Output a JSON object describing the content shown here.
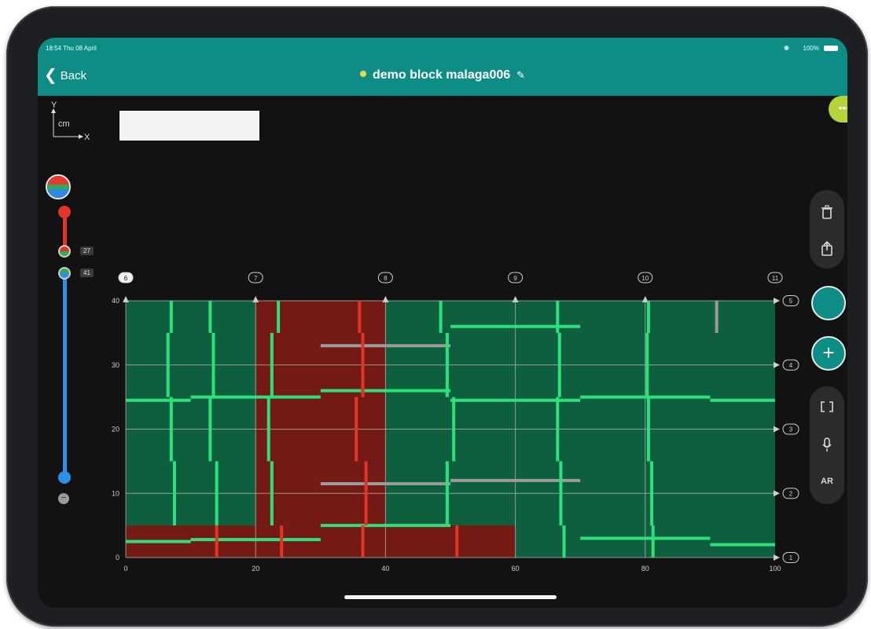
{
  "status": {
    "time": "18:54 Thu 08 April",
    "wifi_icon": "wifi-icon",
    "battery": "100%"
  },
  "nav": {
    "back_label": "Back",
    "title": "demo block malaga006",
    "edit_icon": "pencil-icon"
  },
  "axes_indicator": {
    "y": "Y",
    "unit": "cm",
    "x": "X"
  },
  "layer_slider": {
    "upper_tag": "27",
    "lower_tag": "41"
  },
  "toolbar": {
    "top": [
      "trash-icon",
      "share-icon"
    ],
    "bottom": [
      "brackets-icon",
      "microphone-icon",
      "ar-icon"
    ],
    "ar_label": "AR",
    "color_button": "#0e8d87",
    "more_icon": "ellipsis-icon",
    "add_icon": "plus-icon"
  },
  "colors": {
    "accent": "#0e8d87",
    "grid_green": "#0d5f3e",
    "grid_red": "#741a14",
    "line_green": "#2ee07c",
    "line_red": "#e3342a",
    "line_grey": "#9b9b9b"
  },
  "chart_data": {
    "type": "heatmap",
    "xlim": [
      0,
      100
    ],
    "ylim": [
      0,
      40
    ],
    "x_ticks": [
      "0",
      "20",
      "40",
      "60",
      "80",
      "100"
    ],
    "y_ticks": [
      "0",
      "10",
      "20",
      "30",
      "40"
    ],
    "top_markers": [
      "6",
      "7",
      "8",
      "9",
      "10",
      "11"
    ],
    "right_markers": [
      "1",
      "2",
      "3",
      "4",
      "5"
    ],
    "regions": [
      {
        "color": "red",
        "x": [
          20,
          40
        ],
        "y": [
          5,
          40
        ]
      },
      {
        "color": "red",
        "x": [
          0,
          60
        ],
        "y": [
          0,
          5
        ]
      }
    ],
    "segments": [
      {
        "c": "g",
        "x1": 0,
        "y1": 24.5,
        "x2": 10,
        "y2": 24.5
      },
      {
        "c": "g",
        "x1": 10,
        "y1": 25,
        "x2": 30,
        "y2": 25
      },
      {
        "c": "g",
        "x1": 30,
        "y1": 26,
        "x2": 50,
        "y2": 26
      },
      {
        "c": "g",
        "x1": 50,
        "y1": 24.5,
        "x2": 70,
        "y2": 24.5
      },
      {
        "c": "g",
        "x1": 70,
        "y1": 25,
        "x2": 90,
        "y2": 25
      },
      {
        "c": "g",
        "x1": 90,
        "y1": 24.5,
        "x2": 100,
        "y2": 24.5
      },
      {
        "c": "g",
        "x1": 0,
        "y1": 2.5,
        "x2": 10,
        "y2": 2.5
      },
      {
        "c": "g",
        "x1": 10,
        "y1": 2.8,
        "x2": 30,
        "y2": 2.8
      },
      {
        "c": "g",
        "x1": 30,
        "y1": 5,
        "x2": 50,
        "y2": 5
      },
      {
        "c": "g",
        "x1": 70,
        "y1": 3,
        "x2": 90,
        "y2": 3
      },
      {
        "c": "g",
        "x1": 90,
        "y1": 2,
        "x2": 100,
        "y2": 2
      },
      {
        "c": "g",
        "x1": 50,
        "y1": 36,
        "x2": 70,
        "y2": 36
      },
      {
        "c": "grey",
        "x1": 30,
        "y1": 33,
        "x2": 50,
        "y2": 33
      },
      {
        "c": "grey",
        "x1": 30,
        "y1": 11.5,
        "x2": 50,
        "y2": 11.5
      },
      {
        "c": "grey",
        "x1": 50,
        "y1": 12,
        "x2": 70,
        "y2": 12
      },
      {
        "c": "grey",
        "x1": 91,
        "y1": 40,
        "x2": 91,
        "y2": 35
      },
      {
        "c": "g",
        "x1": 7,
        "y1": 40,
        "x2": 7,
        "y2": 35
      },
      {
        "c": "g",
        "x1": 6.5,
        "y1": 35,
        "x2": 6.5,
        "y2": 25
      },
      {
        "c": "g",
        "x1": 7,
        "y1": 25,
        "x2": 7,
        "y2": 15
      },
      {
        "c": "g",
        "x1": 7.5,
        "y1": 15,
        "x2": 7.5,
        "y2": 5
      },
      {
        "c": "g",
        "x1": 13,
        "y1": 40,
        "x2": 13,
        "y2": 35
      },
      {
        "c": "g",
        "x1": 13.5,
        "y1": 35,
        "x2": 13.5,
        "y2": 25
      },
      {
        "c": "g",
        "x1": 13,
        "y1": 25,
        "x2": 13,
        "y2": 15
      },
      {
        "c": "g",
        "x1": 14,
        "y1": 15,
        "x2": 14,
        "y2": 5
      },
      {
        "c": "g",
        "x1": 23.5,
        "y1": 40,
        "x2": 23.5,
        "y2": 35
      },
      {
        "c": "g",
        "x1": 22.5,
        "y1": 35,
        "x2": 22.5,
        "y2": 25
      },
      {
        "c": "g",
        "x1": 22,
        "y1": 25,
        "x2": 22,
        "y2": 15
      },
      {
        "c": "g",
        "x1": 22.5,
        "y1": 15,
        "x2": 22.5,
        "y2": 5
      },
      {
        "c": "g",
        "x1": 48.5,
        "y1": 40,
        "x2": 48.5,
        "y2": 35
      },
      {
        "c": "g",
        "x1": 49.5,
        "y1": 35,
        "x2": 49.5,
        "y2": 25
      },
      {
        "c": "g",
        "x1": 50.5,
        "y1": 25,
        "x2": 50.5,
        "y2": 15
      },
      {
        "c": "g",
        "x1": 49.5,
        "y1": 15,
        "x2": 49.5,
        "y2": 5
      },
      {
        "c": "g",
        "x1": 66.5,
        "y1": 40,
        "x2": 66.5,
        "y2": 35
      },
      {
        "c": "g",
        "x1": 66.8,
        "y1": 35,
        "x2": 66.8,
        "y2": 25
      },
      {
        "c": "g",
        "x1": 66.5,
        "y1": 25,
        "x2": 66.5,
        "y2": 15
      },
      {
        "c": "g",
        "x1": 67,
        "y1": 15,
        "x2": 67,
        "y2": 5
      },
      {
        "c": "g",
        "x1": 67.5,
        "y1": 5,
        "x2": 67.5,
        "y2": 0
      },
      {
        "c": "g",
        "x1": 80.5,
        "y1": 40,
        "x2": 80.5,
        "y2": 35
      },
      {
        "c": "g",
        "x1": 80.3,
        "y1": 35,
        "x2": 80.3,
        "y2": 25
      },
      {
        "c": "g",
        "x1": 80.5,
        "y1": 25,
        "x2": 80.5,
        "y2": 15
      },
      {
        "c": "g",
        "x1": 81,
        "y1": 15,
        "x2": 81,
        "y2": 5
      },
      {
        "c": "g",
        "x1": 81.2,
        "y1": 5,
        "x2": 81.2,
        "y2": 0
      },
      {
        "c": "r",
        "x1": 36,
        "y1": 40,
        "x2": 36,
        "y2": 35
      },
      {
        "c": "r",
        "x1": 36.5,
        "y1": 35,
        "x2": 36.5,
        "y2": 25
      },
      {
        "c": "r",
        "x1": 35.5,
        "y1": 25,
        "x2": 35.5,
        "y2": 15
      },
      {
        "c": "r",
        "x1": 37,
        "y1": 15,
        "x2": 37,
        "y2": 5
      },
      {
        "c": "r",
        "x1": 36.5,
        "y1": 5,
        "x2": 36.5,
        "y2": 0
      },
      {
        "c": "r",
        "x1": 14,
        "y1": 5,
        "x2": 14,
        "y2": 0
      },
      {
        "c": "r",
        "x1": 24,
        "y1": 5,
        "x2": 24,
        "y2": 0
      },
      {
        "c": "r",
        "x1": 51,
        "y1": 5,
        "x2": 51,
        "y2": 0
      }
    ]
  }
}
